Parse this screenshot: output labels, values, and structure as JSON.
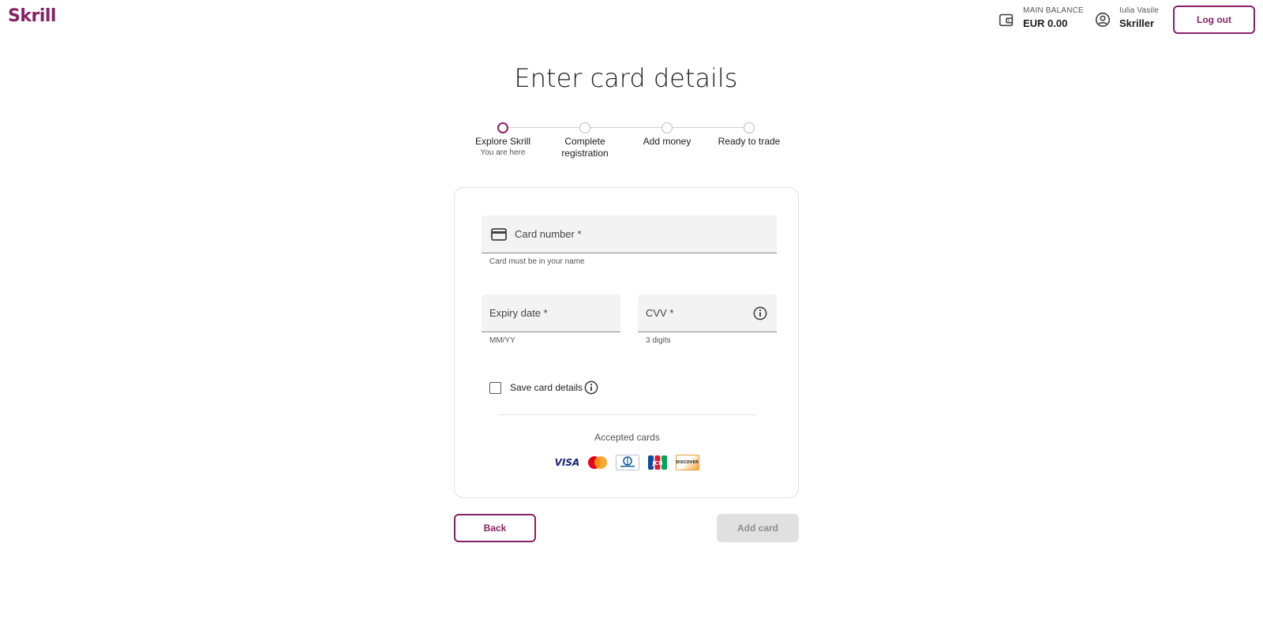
{
  "header": {
    "logo": "Skrill",
    "balance_label": "MAIN BALANCE",
    "balance_value": "EUR 0.00",
    "user_name": "Iulia Vasile",
    "user_role": "Skriller",
    "logout_label": "Log out"
  },
  "page_title": "Enter card details",
  "stepper": {
    "steps": [
      {
        "label": "Explore Skrill",
        "sub": "You are here"
      },
      {
        "label": "Complete registration",
        "sub": ""
      },
      {
        "label": "Add money",
        "sub": ""
      },
      {
        "label": "Ready to trade",
        "sub": ""
      }
    ],
    "active_step": 1
  },
  "form": {
    "card_number_label": "Card number *",
    "card_number_helper": "Card must be in your name",
    "expiry_label": "Expiry date *",
    "expiry_helper": "MM/YY",
    "cvv_label": "CVV *",
    "cvv_helper": "3 digits",
    "save_card_label": "Save card details",
    "save_card_checked": false,
    "accepted_cards_label": "Accepted cards",
    "card_brands": [
      "VISA",
      "Mastercard",
      "Diners Club",
      "JCB",
      "DISCOVER"
    ]
  },
  "actions": {
    "back_label": "Back",
    "add_card_label": "Add card"
  },
  "colors": {
    "brand": "#862165",
    "disabled_bg": "#e0e0e0",
    "field_bg": "#f3f3f3"
  }
}
